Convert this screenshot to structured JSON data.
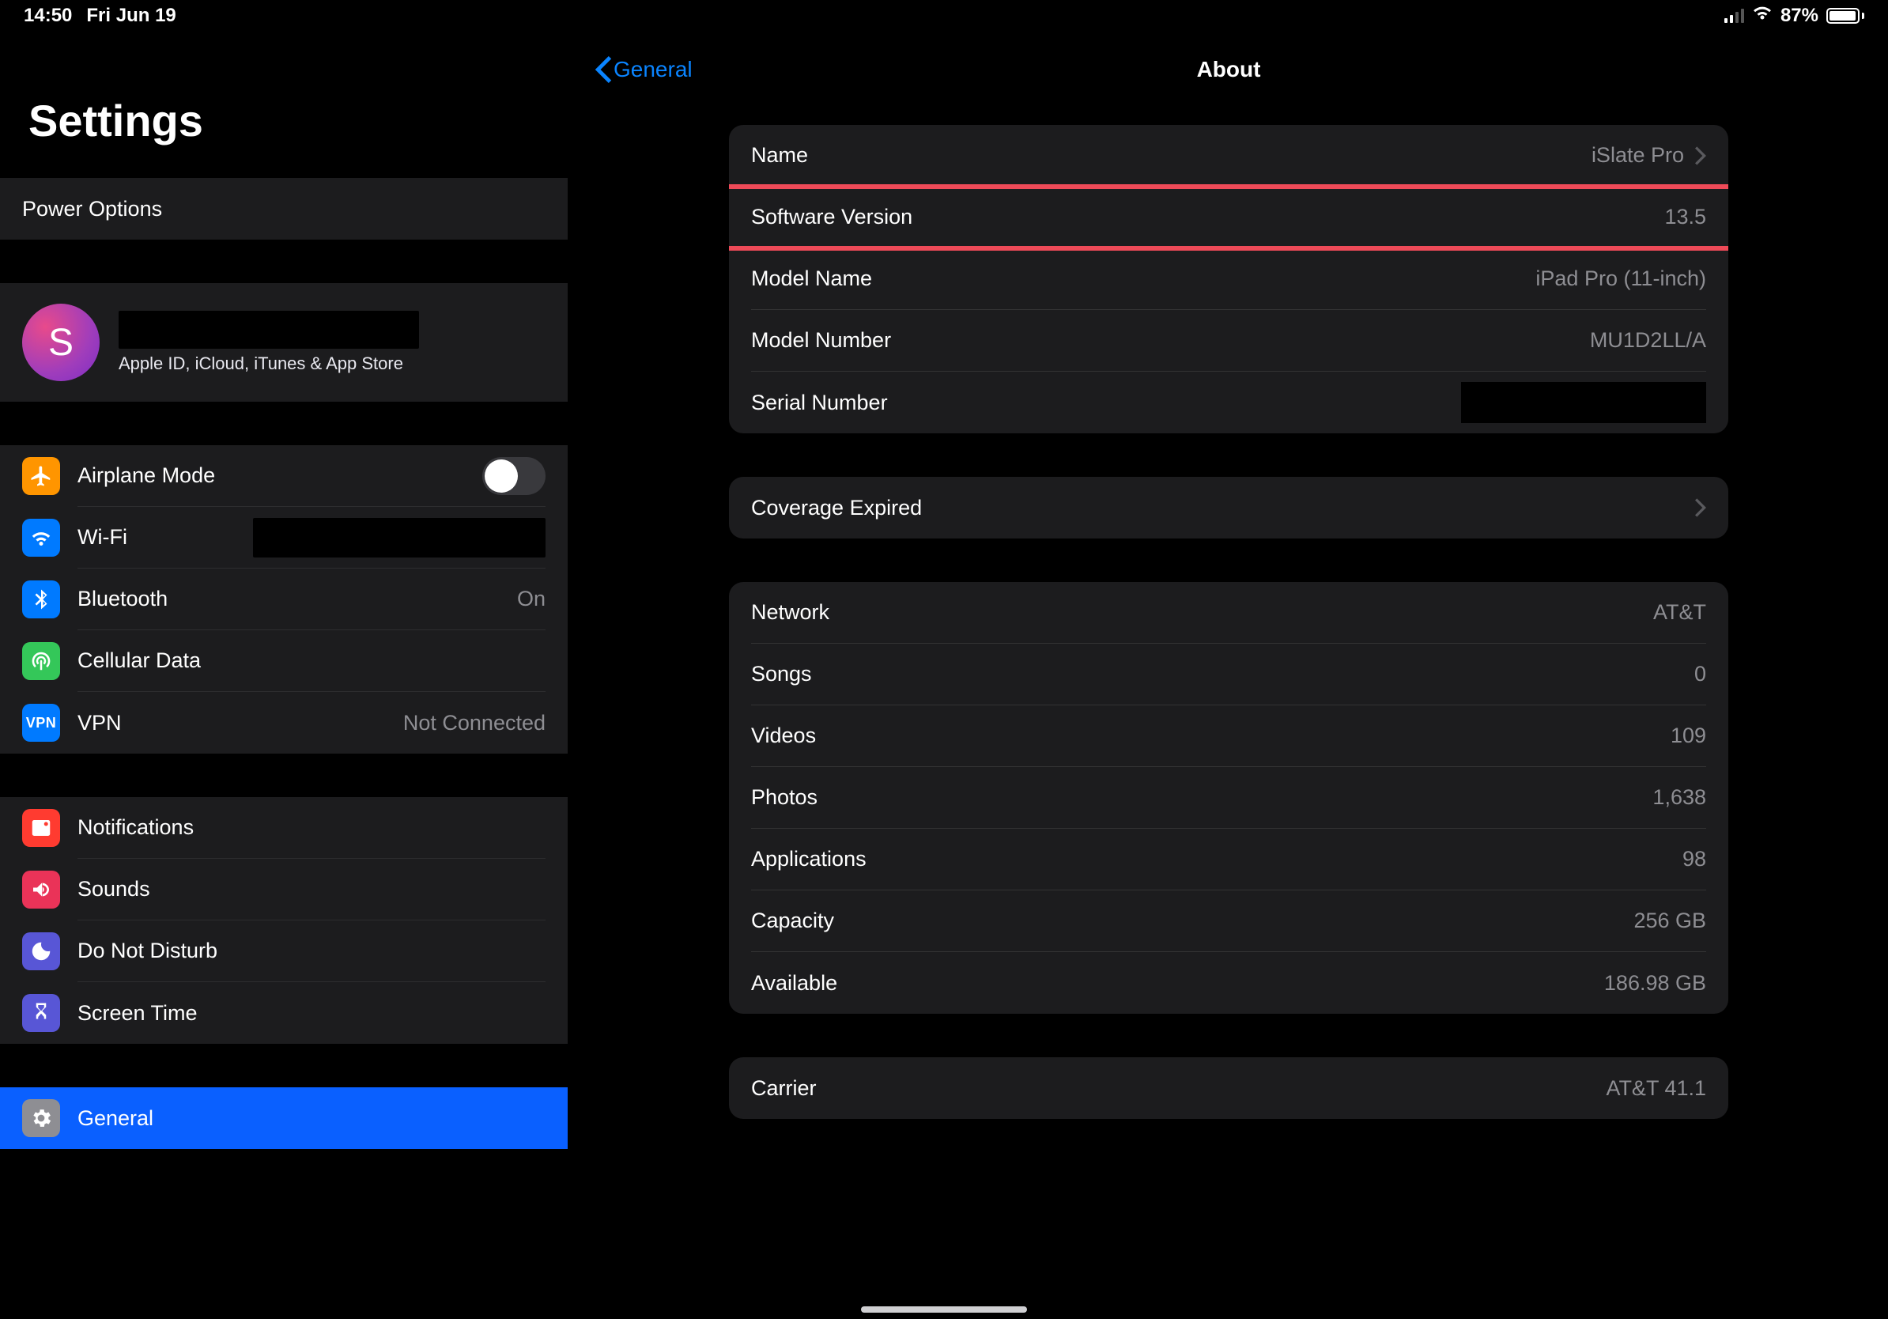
{
  "status": {
    "time": "14:50",
    "date": "Fri Jun 19",
    "battery_pct": "87%"
  },
  "sidebar": {
    "title": "Settings",
    "power_options": "Power Options",
    "apple_id_initial": "S",
    "apple_id_sub": "Apple ID, iCloud, iTunes & App Store",
    "airplane": "Airplane Mode",
    "wifi": "Wi-Fi",
    "bluetooth": "Bluetooth",
    "bluetooth_value": "On",
    "cellular": "Cellular Data",
    "vpn": "VPN",
    "vpn_value": "Not Connected",
    "vpn_badge": "VPN",
    "notifications": "Notifications",
    "sounds": "Sounds",
    "dnd": "Do Not Disturb",
    "screen_time": "Screen Time",
    "general": "General"
  },
  "detail": {
    "back": "General",
    "title": "About",
    "rows": {
      "name_l": "Name",
      "name_v": "iSlate Pro",
      "sw_l": "Software Version",
      "sw_v": "13.5",
      "model_name_l": "Model Name",
      "model_name_v": "iPad Pro (11-inch)",
      "model_num_l": "Model Number",
      "model_num_v": "MU1D2LL/A",
      "serial_l": "Serial Number",
      "coverage_l": "Coverage Expired",
      "network_l": "Network",
      "network_v": "AT&T",
      "songs_l": "Songs",
      "songs_v": "0",
      "videos_l": "Videos",
      "videos_v": "109",
      "photos_l": "Photos",
      "photos_v": "1,638",
      "apps_l": "Applications",
      "apps_v": "98",
      "capacity_l": "Capacity",
      "capacity_v": "256 GB",
      "available_l": "Available",
      "available_v": "186.98 GB",
      "carrier_l": "Carrier",
      "carrier_v": "AT&T 41.1"
    }
  }
}
